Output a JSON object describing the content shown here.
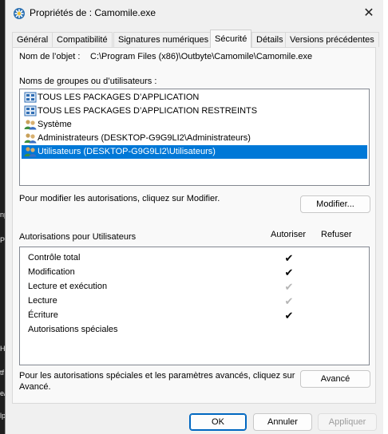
{
  "window": {
    "title": "Propriétés de : Camomile.exe"
  },
  "tabs": [
    {
      "label": "Général"
    },
    {
      "label": "Compatibilité"
    },
    {
      "label": "Signatures numériques"
    },
    {
      "label": "Sécurité"
    },
    {
      "label": "Détails"
    },
    {
      "label": "Versions précédentes"
    }
  ],
  "object": {
    "label": "Nom de l’objet :",
    "path": "C:\\Program Files (x86)\\Outbyte\\Camomile\\Camomile.exe"
  },
  "groups": {
    "label": "Noms de groupes ou d’utilisateurs :",
    "items": [
      {
        "label": "TOUS LES PACKAGES D’APPLICATION",
        "icon": "app-package-icon"
      },
      {
        "label": "TOUS LES PACKAGES D’APPLICATION RESTREINTS",
        "icon": "app-package-icon"
      },
      {
        "label": "Système",
        "icon": "users-icon"
      },
      {
        "label": "Administrateurs (DESKTOP-G9G9LI2\\Administrateurs)",
        "icon": "users-icon"
      },
      {
        "label": "Utilisateurs (DESKTOP-G9G9LI2\\Utilisateurs)",
        "icon": "users-icon",
        "selected": true
      }
    ]
  },
  "modify": {
    "text": "Pour modifier les autorisations, cliquez sur Modifier.",
    "button": "Modifier..."
  },
  "permissions": {
    "title": "Autorisations pour Utilisateurs",
    "col_allow": "Autoriser",
    "col_deny": "Refuser",
    "rows": [
      {
        "label": "Contrôle total",
        "allow": "check-dark"
      },
      {
        "label": "Modification",
        "allow": "check-dark"
      },
      {
        "label": "Lecture et exécution",
        "allow": "check-gray"
      },
      {
        "label": "Lecture",
        "allow": "check-gray"
      },
      {
        "label": "Écriture",
        "allow": "check-dark"
      },
      {
        "label": "Autorisations spéciales",
        "allow": "none"
      }
    ]
  },
  "advanced": {
    "text_line1": "Pour les autorisations spéciales et les paramètres avancés, cliquez sur",
    "text_line2": "Avancé.",
    "button": "Avancé"
  },
  "footer": {
    "ok": "OK",
    "cancel": "Annuler",
    "apply": "Appliquer"
  },
  "background_fragments": [
    "np",
    "Pr",
    "H",
    "tf",
    "e/",
    "lp"
  ],
  "colors": {
    "selection": "#0078d7",
    "primary_border": "#0067c0"
  }
}
